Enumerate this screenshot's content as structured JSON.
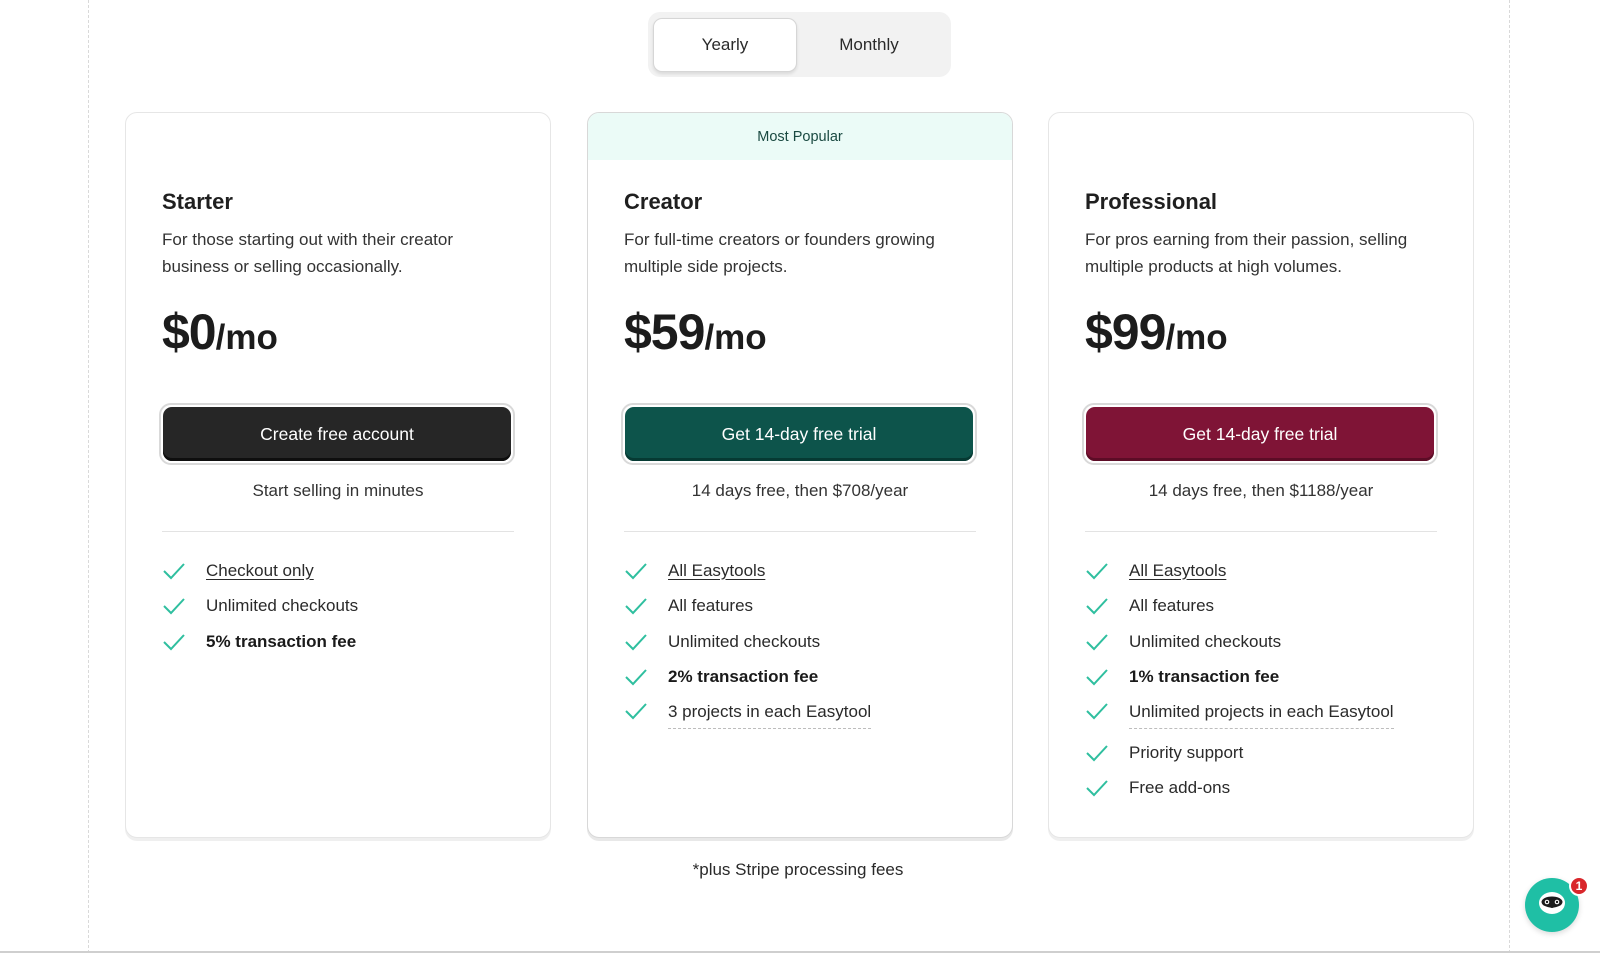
{
  "billing_toggle": {
    "options": [
      "Yearly",
      "Monthly"
    ],
    "selected": "Yearly"
  },
  "plans": [
    {
      "name": "Starter",
      "description": "For those starting out with their creator business or selling occasionally.",
      "price": "$0",
      "period": "/mo",
      "cta_label": "Create free account",
      "cta_note": "Start selling in minutes",
      "features": [
        "Checkout only",
        "Unlimited checkouts",
        "5% transaction fee"
      ]
    },
    {
      "badge": "Most Popular",
      "name": "Creator",
      "description": "For full-time creators or founders growing multiple side projects.",
      "price": "$59",
      "period": "/mo",
      "cta_label": "Get 14-day free trial",
      "cta_note": "14 days free, then $708/year",
      "features": [
        "All Easytools",
        "All features",
        "Unlimited checkouts",
        "2% transaction fee",
        "3 projects in each Easytool"
      ]
    },
    {
      "name": "Professional",
      "description": "For pros earning from their passion, selling multiple products at high volumes.",
      "price": "$99",
      "period": "/mo",
      "cta_label": "Get 14-day free trial",
      "cta_note": "14 days free, then $1188/year",
      "features": [
        "All Easytools",
        "All features",
        "Unlimited checkouts",
        "1% transaction fee",
        "Unlimited projects in each Easytool",
        "Priority support",
        "Free add-ons"
      ]
    }
  ],
  "footnote": "*plus Stripe processing fees",
  "chat_widget": {
    "unread_count": "1",
    "icon": "sloth-face-icon"
  },
  "colors": {
    "check": "#2fbf9f",
    "creator_cta": "#0d544b",
    "professional_cta": "#7f1436",
    "starter_cta": "#262626",
    "popular_ribbon": "#ebfbf7",
    "chat_bubble": "#1fbfa5"
  }
}
